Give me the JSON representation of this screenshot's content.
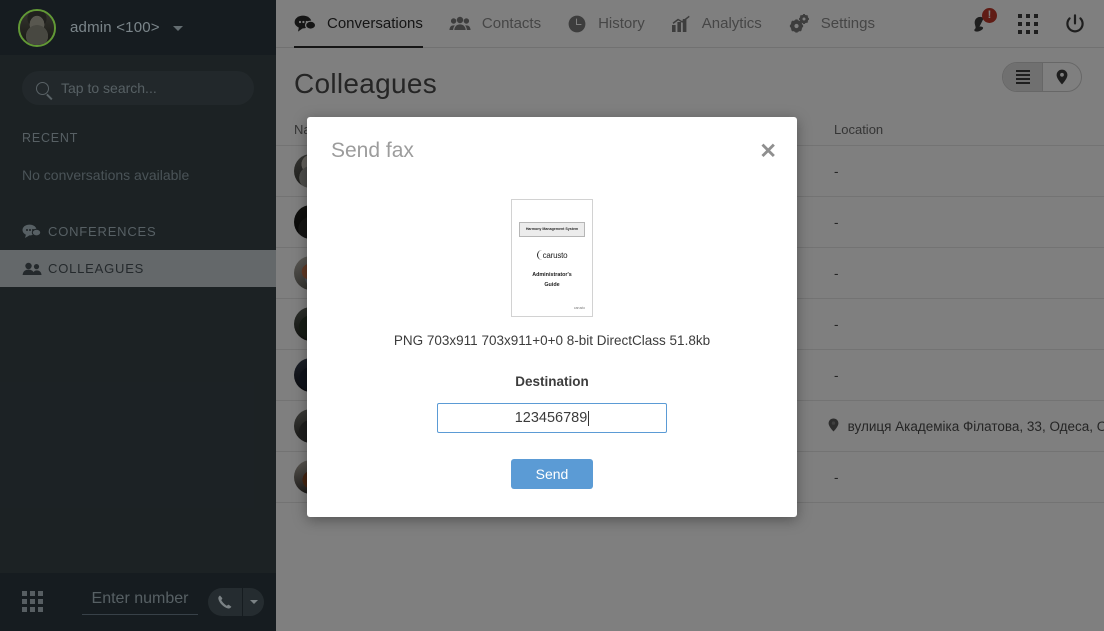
{
  "sidebar": {
    "user": "admin <100>",
    "search_placeholder": "Tap to search...",
    "recent_label": "RECENT",
    "empty_text": "No conversations available",
    "items": [
      {
        "label": "CONFERENCES",
        "icon": "conference-icon",
        "active": false
      },
      {
        "label": "COLLEAGUES",
        "icon": "people-icon",
        "active": true
      }
    ],
    "bottom": {
      "number_placeholder": "Enter number",
      "dialpad_icon": "dialpad-icon",
      "call_icon": "phone-icon",
      "call_dropdown_icon": "chevron-down-icon"
    }
  },
  "topnav": {
    "tabs": [
      {
        "label": "Conversations",
        "icon": "chat-icon",
        "active": true
      },
      {
        "label": "Contacts",
        "icon": "people-icon",
        "active": false
      },
      {
        "label": "History",
        "icon": "clock-icon",
        "active": false
      },
      {
        "label": "Analytics",
        "icon": "chart-icon",
        "active": false
      },
      {
        "label": "Settings",
        "icon": "gears-icon",
        "active": false
      }
    ],
    "notifications": {
      "icon": "bell-icon",
      "badge": "!"
    },
    "apps_icon": "apps-grid-icon",
    "power_icon": "power-icon"
  },
  "page": {
    "title": "Colleagues",
    "view_toggle": {
      "list_icon": "list-view-icon",
      "map_icon": "map-pin-icon",
      "active": "list"
    },
    "table": {
      "columns": [
        "Name",
        "Location"
      ],
      "rows": [
        {
          "location": "-"
        },
        {
          "location": "-"
        },
        {
          "location": "-"
        },
        {
          "location": "-"
        },
        {
          "location": "-"
        },
        {
          "location": "вулиця Академіка Філатова, 33, Одеса, О"
        },
        {
          "location": "-"
        }
      ]
    }
  },
  "dialog": {
    "title": "Send fax",
    "close_icon": "close-icon",
    "thumbnail": {
      "band": "Harmony Management System",
      "logo": "carusto",
      "subtitle_line1": "Administrator's",
      "subtitle_line2": "Guide",
      "footer_logo": "carusto"
    },
    "file_info": "PNG 703x911 703x911+0+0 8-bit DirectClass 51.8kb",
    "destination_label": "Destination",
    "destination_value": "123456789",
    "send_label": "Send",
    "accent_color": "#5b9bd5"
  }
}
